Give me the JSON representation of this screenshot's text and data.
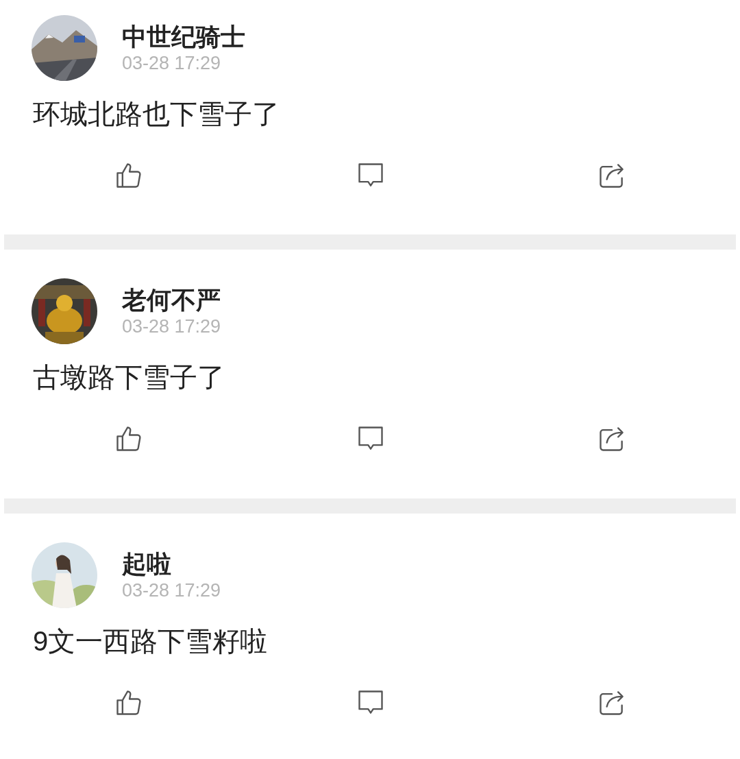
{
  "posts": [
    {
      "author": "中世纪骑士",
      "time": "03-28 17:29",
      "text": "环城北路也下雪子了"
    },
    {
      "author": "老何不严",
      "time": "03-28 17:29",
      "text": "古墩路下雪子了"
    },
    {
      "author": "起啦",
      "time": "03-28 17:29",
      "text": "9文一西路下雪籽啦"
    }
  ]
}
